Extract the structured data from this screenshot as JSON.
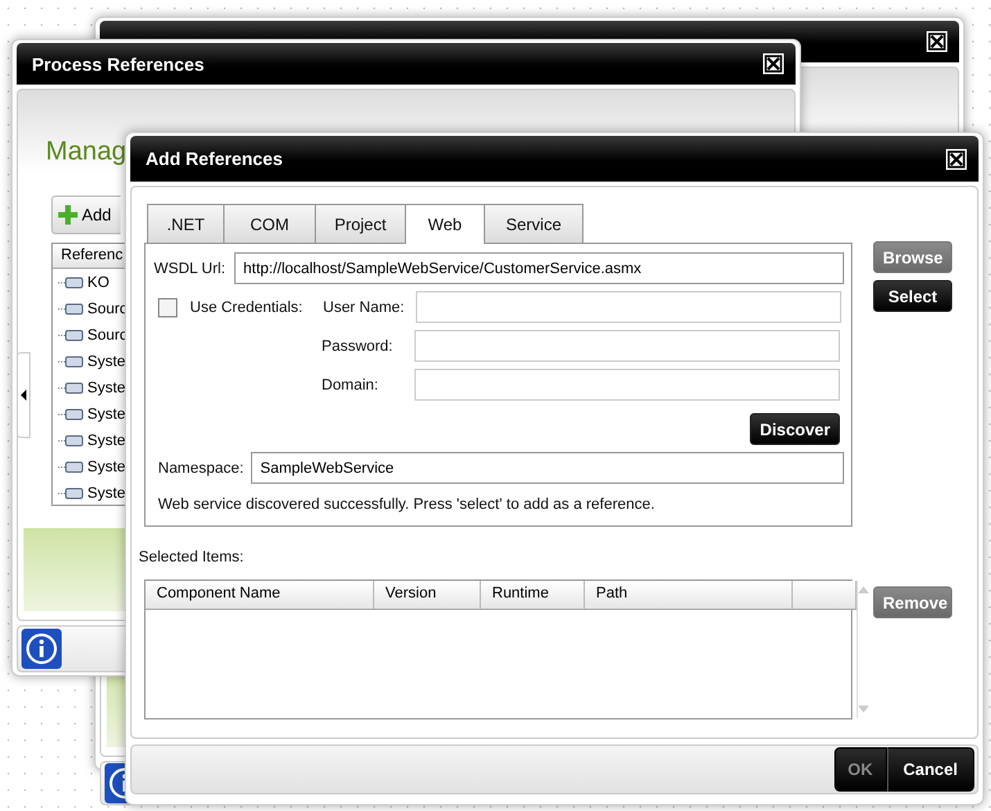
{
  "process_references": {
    "title": "Process References",
    "heading": "Manag",
    "add_button": "Add",
    "tree": {
      "header": "Referenc",
      "items": [
        {
          "label": "KO"
        },
        {
          "label": "Sourc"
        },
        {
          "label": "Sourc"
        },
        {
          "label": "Syste"
        },
        {
          "label": "Syste"
        },
        {
          "label": "Syste"
        },
        {
          "label": "Syste"
        },
        {
          "label": "Syste"
        },
        {
          "label": "Syste"
        }
      ]
    }
  },
  "add_references": {
    "title": "Add References",
    "tabs": [
      {
        "label": ".NET",
        "selected": false
      },
      {
        "label": "COM",
        "selected": false
      },
      {
        "label": "Project",
        "selected": false
      },
      {
        "label": "Web",
        "selected": true
      },
      {
        "label": "Service",
        "selected": false
      }
    ],
    "wsdl_url": {
      "label": "WSDL Url:",
      "value": "http://localhost/SampleWebService/CustomerService.asmx"
    },
    "use_credentials": {
      "label": "Use Credentials:",
      "checked": false
    },
    "credential_fields": [
      {
        "label": "User Name:"
      },
      {
        "label": "Password:"
      },
      {
        "label": "Domain:"
      }
    ],
    "discover_button": {
      "label": "Discover",
      "disabled": false
    },
    "namespace": {
      "label": "Namespace:",
      "value": "SampleWebService"
    },
    "status": "Web service discovered successfully.  Press 'select' to add as a reference.",
    "side_buttons": [
      {
        "label": "Browse",
        "disabled": true
      },
      {
        "label": "Select",
        "disabled": false
      }
    ],
    "selected_items": {
      "label": "Selected Items:",
      "columns": [
        "Component Name",
        "Version",
        "Runtime",
        "Path"
      ]
    },
    "remove_button": {
      "label": "Remove",
      "disabled": true
    },
    "footer_buttons": [
      {
        "label": "OK",
        "disabled": true
      },
      {
        "label": "Cancel",
        "disabled": false
      }
    ]
  }
}
